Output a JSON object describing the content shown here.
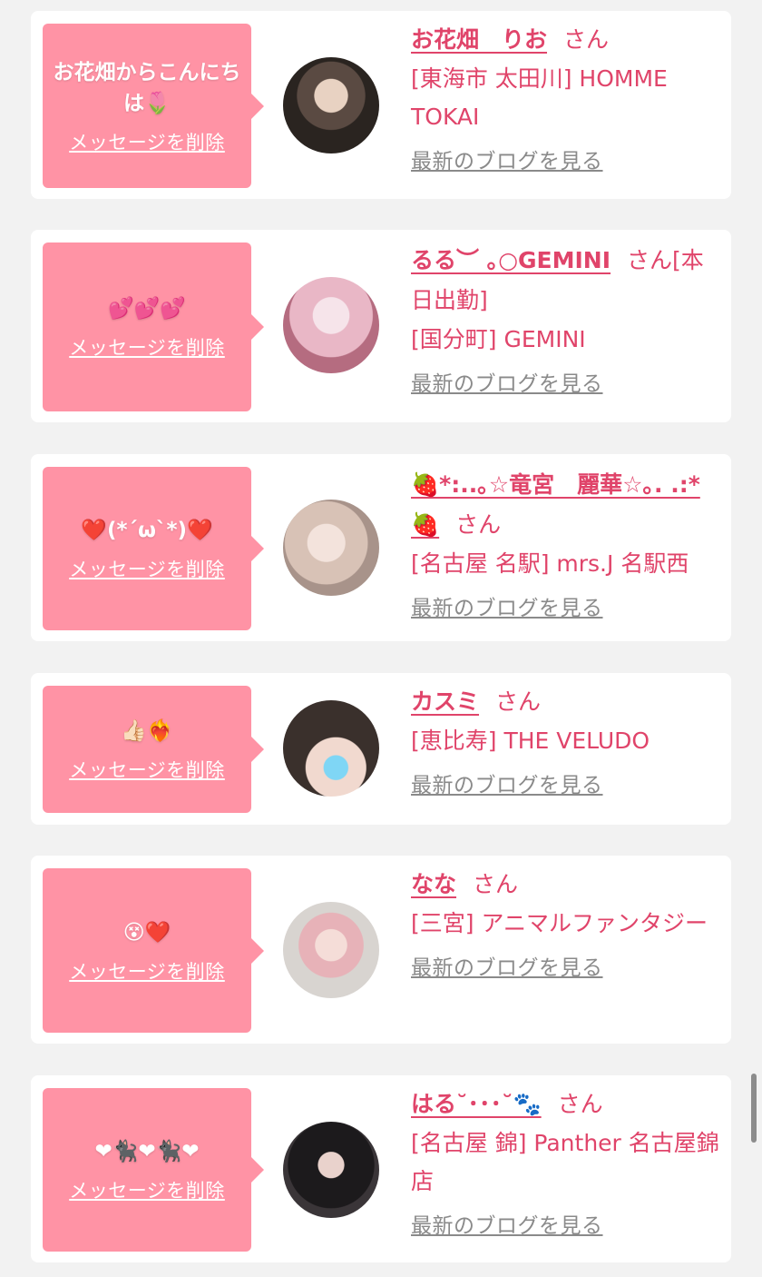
{
  "cards": [
    {
      "message": "お花畑からこんにちは🌷",
      "delete_label": "メッセージを削除",
      "name": "お花畑　りお",
      "san": "さん",
      "shop": "[東海市 太田川] HOMME TOKAI",
      "blog_label": "最新のブログを見る"
    },
    {
      "message": "💕💕💕",
      "delete_label": "メッセージを削除",
      "name": "るる︶ ｡○GEMINI",
      "san": "さん[本日出勤]",
      "shop": "[国分町] GEMINI",
      "blog_label": "最新のブログを見る"
    },
    {
      "message": "❤️(*´ω`*)❤️",
      "delete_label": "メッセージを削除",
      "name": "🍓*:..｡☆竜宮　麗華☆｡. .:*🍓",
      "san": "さん",
      "shop": "[名古屋 名駅] mrs.J 名駅西",
      "blog_label": "最新のブログを見る"
    },
    {
      "message": "👍🏻❤️‍🔥",
      "delete_label": "メッセージを削除",
      "name": "カスミ",
      "san": "さん",
      "shop": "[恵比寿] THE VELUDO",
      "blog_label": "最新のブログを見る"
    },
    {
      "message": "😵❤️",
      "delete_label": "メッセージを削除",
      "name": "なな",
      "san": "さん",
      "shop": "[三宮] アニマルファンタジー",
      "blog_label": "最新のブログを見る"
    },
    {
      "message": "❤🐈‍⬛❤🐈‍⬛❤",
      "delete_label": "メッセージを削除",
      "name": "はる˘･･･˘🐾",
      "san": "さん",
      "shop": "[名古屋 錦] Panther 名古屋錦店",
      "blog_label": "最新のブログを見る"
    }
  ],
  "colors": {
    "accent": "#e0446a",
    "bubble": "#ff93a5",
    "background": "#f2f2f2",
    "link_gray": "#8a8a8a"
  }
}
